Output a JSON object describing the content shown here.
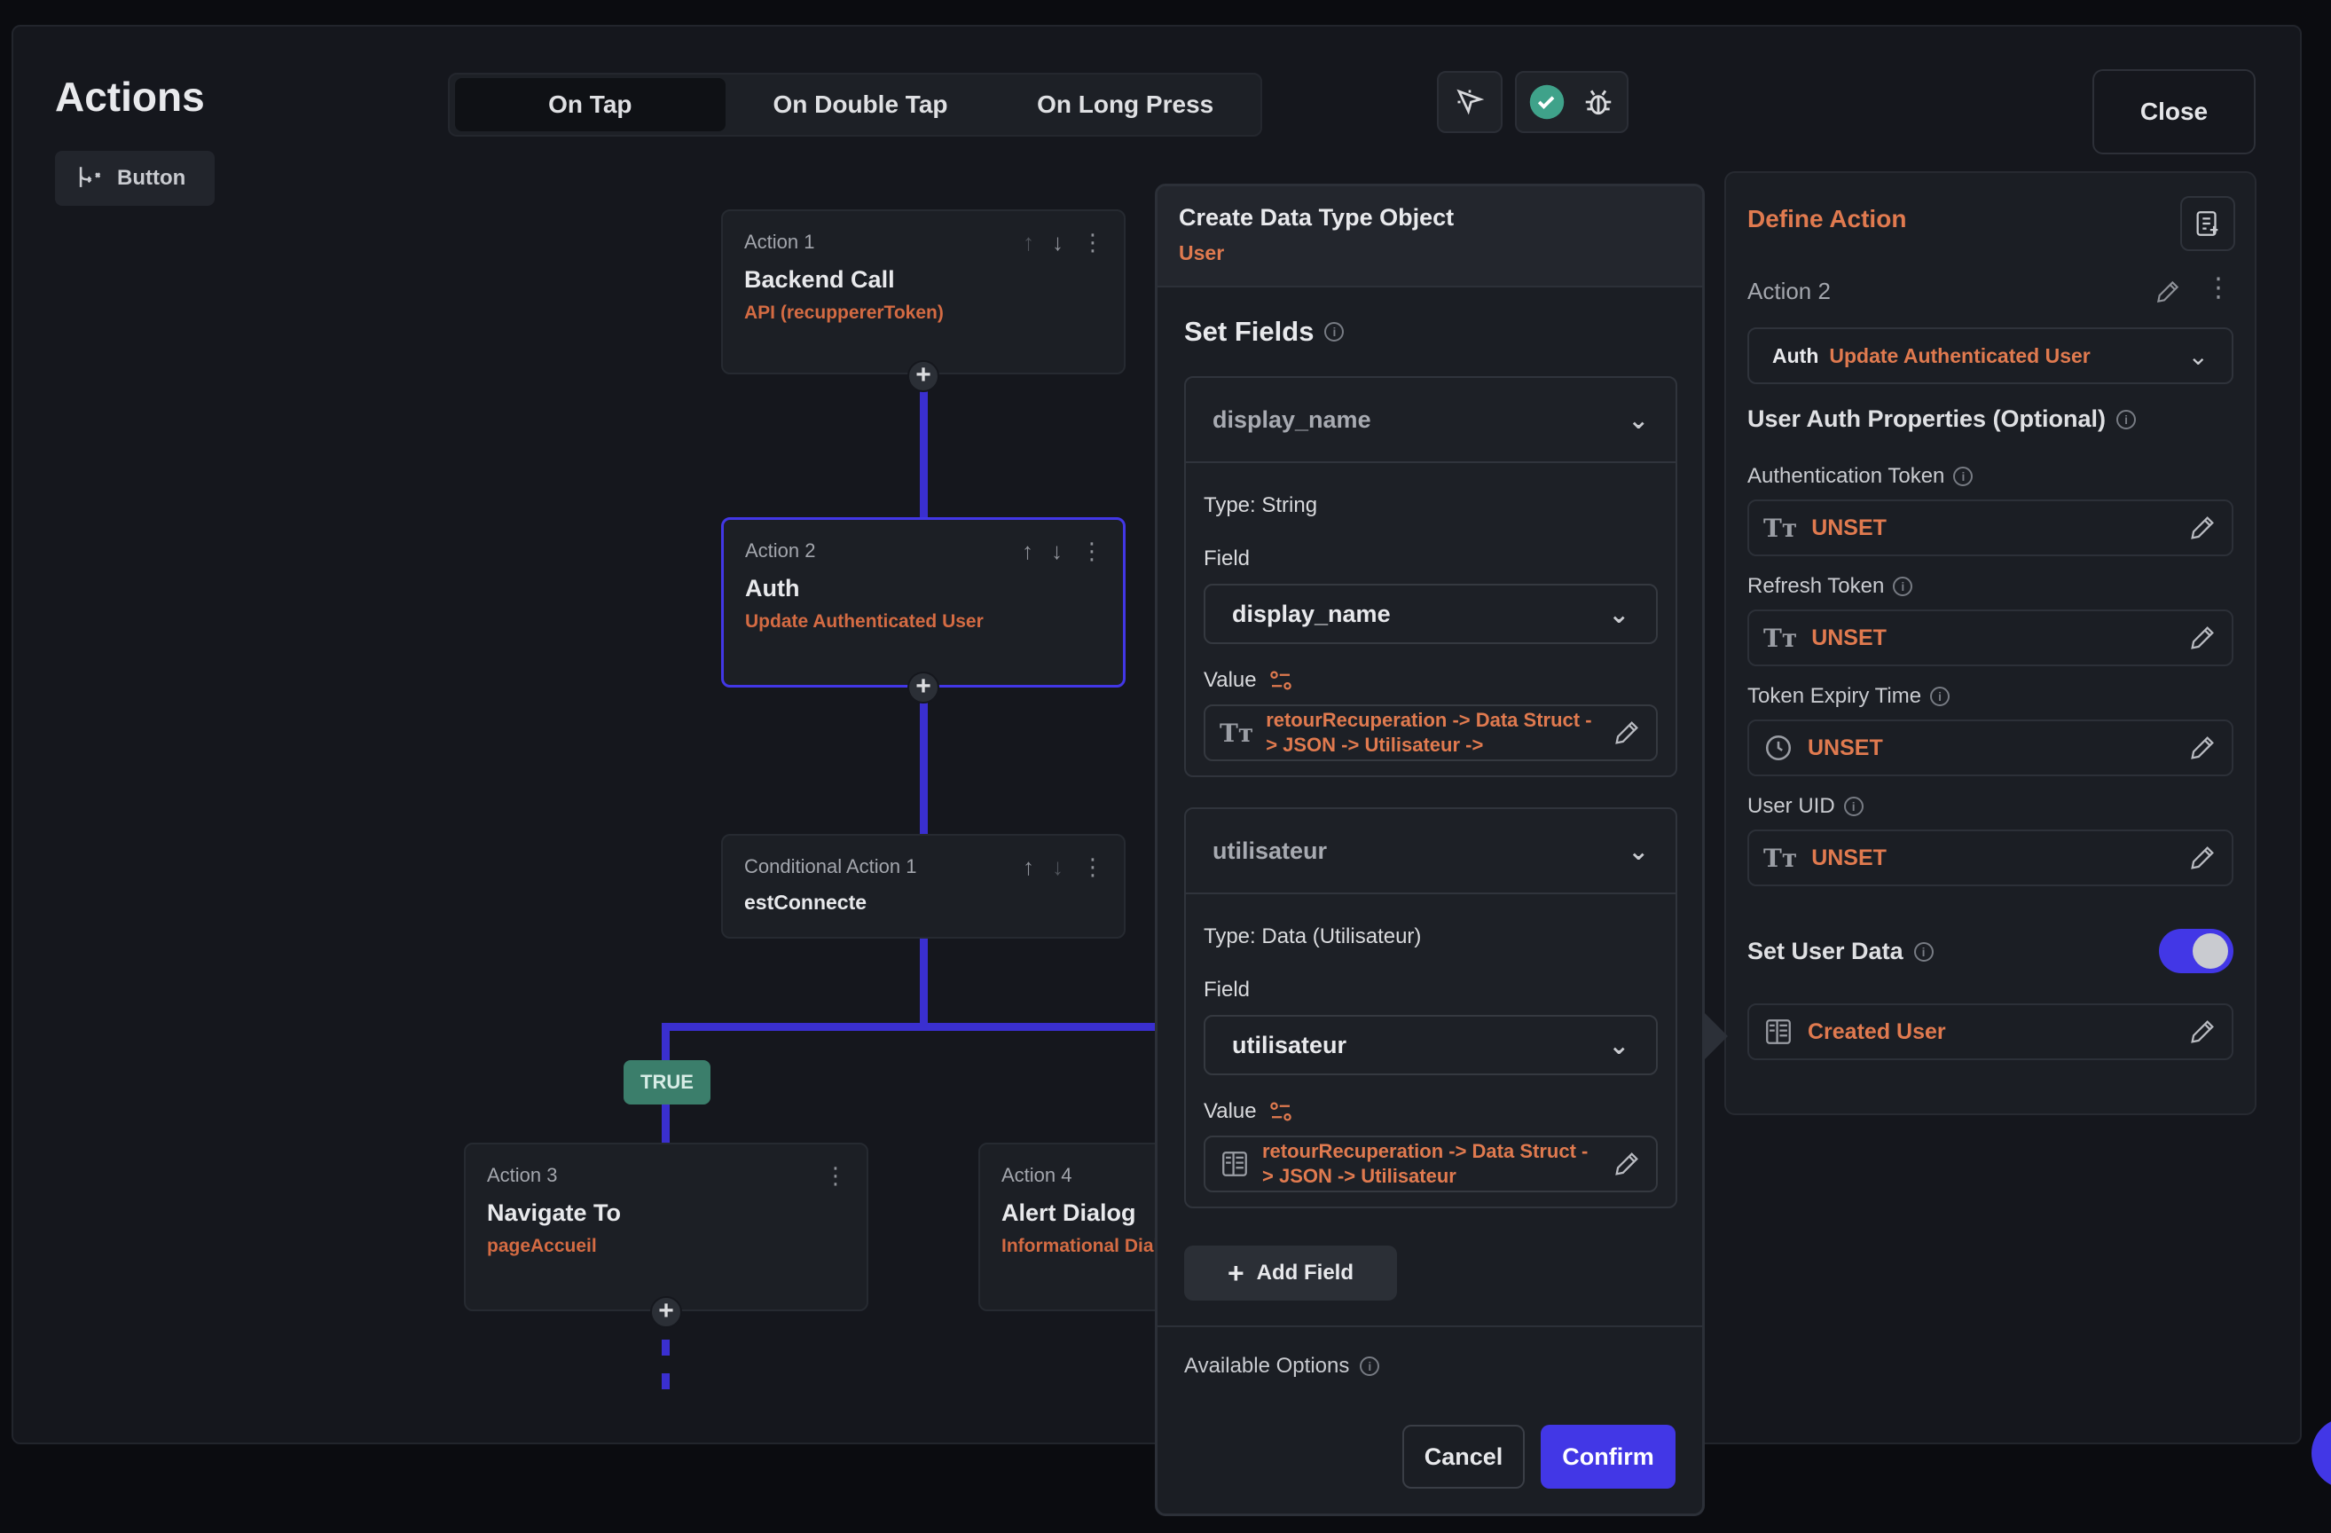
{
  "header": {
    "title": "Actions",
    "widget_chip": "Button",
    "tabs": [
      "On Tap",
      "On Double Tap",
      "On Long Press"
    ],
    "close_label": "Close"
  },
  "flow": {
    "action1": {
      "label": "Action 1",
      "title": "Backend Call",
      "sub": "API (recuppererToken)"
    },
    "action2": {
      "label": "Action 2",
      "title": "Auth",
      "sub": "Update Authenticated User"
    },
    "conditional": {
      "label": "Conditional Action 1",
      "title": "estConnecte"
    },
    "true_badge": "TRUE",
    "action3": {
      "label": "Action 3",
      "title": "Navigate To",
      "sub": "pageAccueil"
    },
    "action4": {
      "label": "Action 4",
      "title": "Alert Dialog",
      "sub": "Informational Dial"
    }
  },
  "dialog": {
    "title": "Create Data Type Object",
    "subtitle": "User",
    "set_fields": "Set Fields",
    "fields": [
      {
        "name": "display_name",
        "type": "Type: String",
        "field_label": "Field",
        "field_value": "display_name",
        "value_label": "Value",
        "value_text": "retourRecuperation -> Data Struct -> JSON -> Utilisateur ->"
      },
      {
        "name": "utilisateur",
        "type": "Type: Data (Utilisateur)",
        "field_label": "Field",
        "field_value": "utilisateur",
        "value_label": "Value",
        "value_text": "retourRecuperation -> Data Struct -> JSON -> Utilisateur"
      }
    ],
    "add_field": "Add Field",
    "available_options": "Available Options",
    "cancel": "Cancel",
    "confirm": "Confirm"
  },
  "define": {
    "title": "Define Action",
    "action_label": "Action 2",
    "select_prefix": "Auth",
    "select_value": "Update Authenticated User",
    "props_title": "User Auth Properties (Optional)",
    "props": [
      {
        "label": "Authentication Token",
        "value": "UNSET",
        "icon": "text-type-icon"
      },
      {
        "label": "Refresh Token",
        "value": "UNSET",
        "icon": "text-type-icon"
      },
      {
        "label": "Token Expiry Time",
        "value": "UNSET",
        "icon": "clock-icon"
      },
      {
        "label": "User UID",
        "value": "UNSET",
        "icon": "text-type-icon"
      }
    ],
    "set_user_data": "Set User Data",
    "set_user_data_on": true,
    "created_user": "Created User"
  },
  "colors": {
    "accent": "#4237e6",
    "orange": "#e07a4f",
    "true_green": "#3b7e6b"
  }
}
